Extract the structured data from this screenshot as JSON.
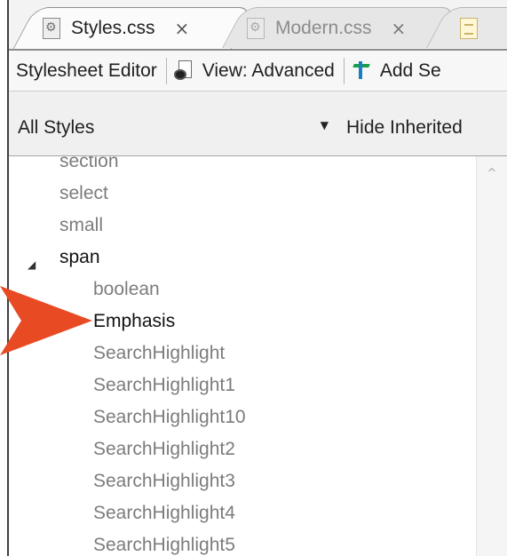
{
  "tabs": [
    {
      "label": "Styles.css",
      "close": "×",
      "state": "active"
    },
    {
      "label": "Modern.css",
      "close": "×",
      "state": "inactive"
    }
  ],
  "toolbar": {
    "title": "Stylesheet Editor",
    "view_label": "View: Advanced",
    "add_label": "Add Se"
  },
  "filter": {
    "selected": "All Styles",
    "caret": "▼",
    "hide_inherited_label": "Hide Inherited"
  },
  "tree": {
    "expander": "◢",
    "items": [
      {
        "label": "section",
        "level": 0,
        "style": "dim"
      },
      {
        "label": "select",
        "level": 0,
        "style": "dim"
      },
      {
        "label": "small",
        "level": 0,
        "style": "dim"
      },
      {
        "label": "span",
        "level": 0,
        "style": "strong",
        "expanded": true
      },
      {
        "label": "boolean",
        "level": 1,
        "style": "dim"
      },
      {
        "label": "Emphasis",
        "level": 1,
        "style": "strong"
      },
      {
        "label": "SearchHighlight",
        "level": 1,
        "style": "dim"
      },
      {
        "label": "SearchHighlight1",
        "level": 1,
        "style": "dim"
      },
      {
        "label": "SearchHighlight10",
        "level": 1,
        "style": "dim"
      },
      {
        "label": "SearchHighlight2",
        "level": 1,
        "style": "dim"
      },
      {
        "label": "SearchHighlight3",
        "level": 1,
        "style": "dim"
      },
      {
        "label": "SearchHighlight4",
        "level": 1,
        "style": "dim"
      },
      {
        "label": "SearchHighlight5",
        "level": 1,
        "style": "dim"
      }
    ]
  },
  "scrollbar": {
    "up_glyph": "^"
  },
  "colors": {
    "callout": "#e84b24",
    "dim_text": "#7c7c7c",
    "strong_text": "#111111"
  }
}
